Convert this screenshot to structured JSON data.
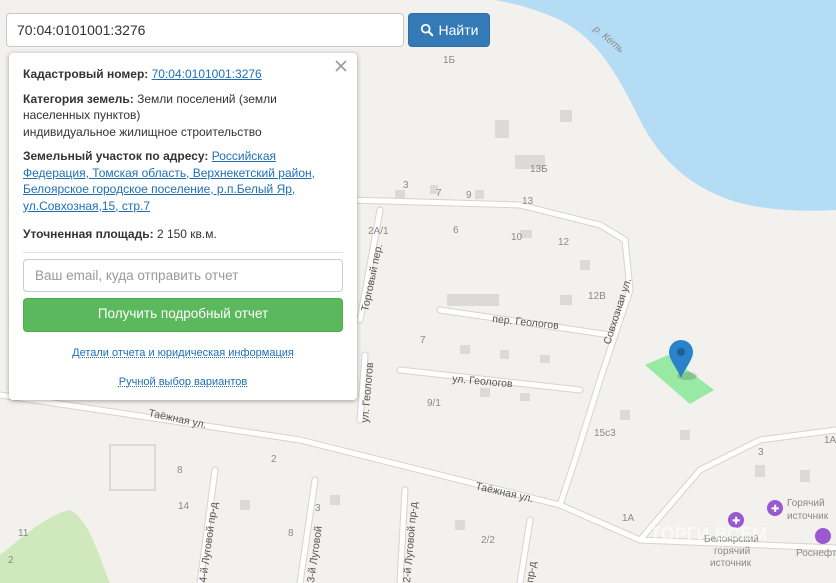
{
  "search": {
    "value": "70:04:0101001:3276",
    "button_label": "Найти",
    "button_icon": "search-icon"
  },
  "popup": {
    "cadastral_label": "Кадастровый номер:",
    "cadastral_value": "70:04:0101001:3276",
    "category_label": "Категория земель:",
    "category_line1": "Земли поселений (земли",
    "category_line2": "населенных пунктов)",
    "category_line3": "индивидуальное жилищное строительство",
    "address_label": "Земельный участок по адресу:",
    "address_line1": "Российская",
    "address_line2": "Федерация, Томская область, Верхнекетский район,",
    "address_line3": "Белоярское городское поселение, р.п.Белый Яр,",
    "address_line4": "ул.Совхозная,15, стр.7",
    "area_label": "Уточненная площадь:",
    "area_value": "2 150 кв.м.",
    "email_placeholder": "Ваш email, куда отправить отчет",
    "report_button": "Получить подробный отчет",
    "details_link": "Детали отчета и юридическая информация",
    "manual_link": "Ручной выбор вариантов"
  },
  "map": {
    "river_name": "р. Кеть",
    "streets": {
      "geologov_lane": "пер. Геологов",
      "geologov_street": "ул. Геологов",
      "geologov_vertical": "ул. Геологов",
      "sovkhoznaya": "Совхозная ул.",
      "torgovy": "Торговый пер.",
      "taezhnaya_left": "Таёжная ул.",
      "taezhnaya_right": "Таёжная ул.",
      "lugovoy4": "4-й Луговой пр-д",
      "lugovoy3": "3-й Луговой",
      "lugovoy2": "2-й Луговой пр-д",
      "lugovoy_pr": "пр-д"
    },
    "house_numbers": [
      "1Б",
      "13Б",
      "3",
      "7",
      "9",
      "13",
      "2А/1",
      "6",
      "10",
      "12",
      "12В",
      "7",
      "9/1",
      "15с3",
      "3",
      "1А",
      "2",
      "8",
      "14",
      "3",
      "8",
      "11",
      "2",
      "2/2",
      "1А"
    ],
    "poi": {
      "hot_spring": "Горячий источник",
      "hot_spring_line1": "Горячий",
      "hot_spring_line2": "источник",
      "belyar_spring_line1": "Белоярский",
      "belyar_spring_line2": "горячий",
      "belyar_spring_line3": "источник",
      "rosneft": "Роснефт",
      "watermark": "ТОРГИ ВСЕМ"
    },
    "colors": {
      "river": "#b4dcf5",
      "land": "#f2f1ee",
      "parcel": "#8ee89a",
      "marker": "#2a83c8",
      "park": "#cfe8bc"
    }
  }
}
